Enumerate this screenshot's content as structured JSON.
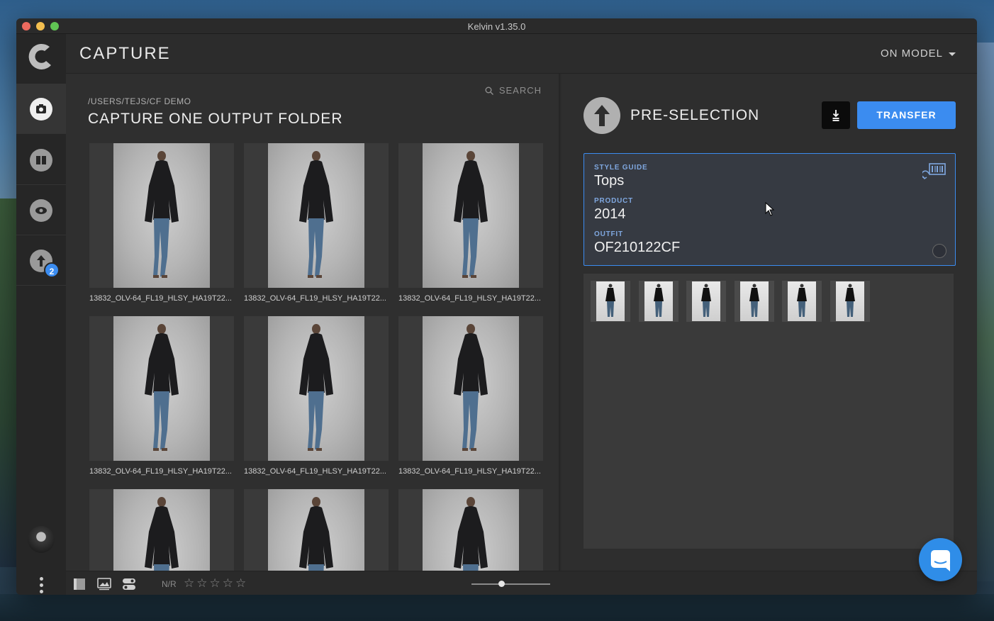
{
  "window": {
    "title": "Kelvin v1.35.0"
  },
  "header": {
    "title": "CAPTURE",
    "mode": "ON MODEL"
  },
  "sidebar": {
    "items": [
      {
        "icon": "camera-icon",
        "active": true
      },
      {
        "icon": "book-icon",
        "active": false
      },
      {
        "icon": "eye-icon",
        "active": false
      },
      {
        "icon": "upload-icon",
        "active": false,
        "badge": "2"
      }
    ]
  },
  "left": {
    "search_label": "SEARCH",
    "path": "/USERS/TEJS/CF DEMO",
    "folder_title": "CAPTURE ONE OUTPUT FOLDER",
    "tiles": [
      {
        "label": "13832_OLV-64_FL19_HLSY_HA19T22..."
      },
      {
        "label": "13832_OLV-64_FL19_HLSY_HA19T22..."
      },
      {
        "label": "13832_OLV-64_FL19_HLSY_HA19T22..."
      },
      {
        "label": "13832_OLV-64_FL19_HLSY_HA19T22..."
      },
      {
        "label": "13832_OLV-64_FL19_HLSY_HA19T22..."
      },
      {
        "label": "13832_OLV-64_FL19_HLSY_HA19T22..."
      },
      {
        "label": ""
      },
      {
        "label": ""
      },
      {
        "label": ""
      }
    ]
  },
  "right": {
    "title": "PRE-SELECTION",
    "transfer_label": "TRANSFER",
    "style_guide_label": "STYLE GUIDE",
    "style_guide_value": "Tops",
    "product_label": "PRODUCT",
    "product_value": "2014",
    "outfit_label": "OUTFIT",
    "outfit_value": "OF210122CF",
    "thumbnail_count": 6
  },
  "bottombar": {
    "rating_label": "N/R",
    "stars": "☆☆☆☆☆",
    "zoom_level": 0.38
  },
  "colors": {
    "accent": "#3b8cf0",
    "background": "#2b2b2b"
  }
}
